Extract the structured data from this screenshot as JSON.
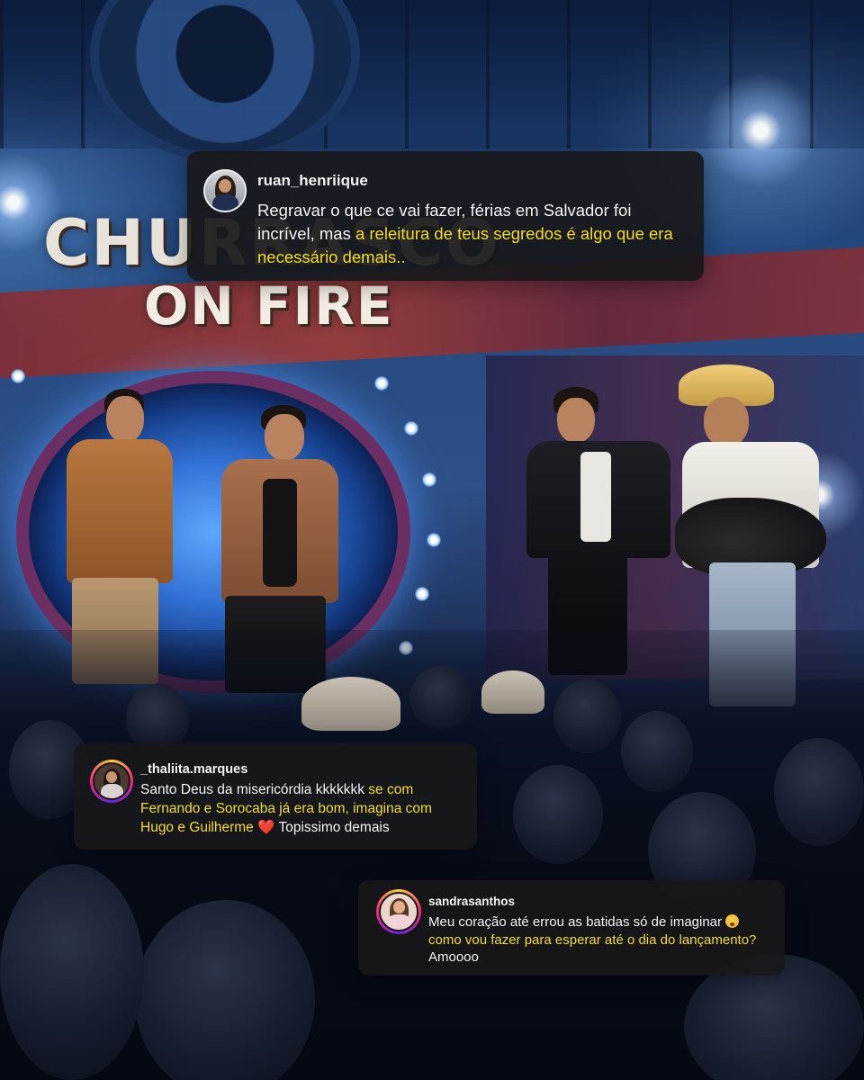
{
  "background": {
    "logo_line1": "CHURRASCO",
    "logo_line2": "ON FIRE"
  },
  "comments": [
    {
      "username": "ruan_henriique",
      "text_before": "Regravar o que ce vai fazer, férias em Salvador foi incrível, mas ",
      "text_highlight": "a releitura de teus segredos é algo que era necessário demais..",
      "text_after": "",
      "avatar_style": "plain"
    },
    {
      "username": "_thaliita.marques",
      "text_before": "Santo Deus da misericórdia kkkkkkk ",
      "text_highlight": "se com Fernando e Sorocaba já era bom, imagina com Hugo e Guilherme",
      "heart": "❤️",
      "text_after": " Topissimo demais",
      "avatar_style": "story"
    },
    {
      "username": "sandrasanthos",
      "text_before": "Meu coração até errou as batidas só de imaginar ",
      "emoji": "😮",
      "text_highlight": "como vou fazer para esperar até o dia do lançamento?",
      "text_after": " Amoooo",
      "avatar_style": "story"
    }
  ],
  "colors": {
    "highlight": "#f3dc25",
    "card_background": "#18181a",
    "text": "#f3f3f3"
  }
}
